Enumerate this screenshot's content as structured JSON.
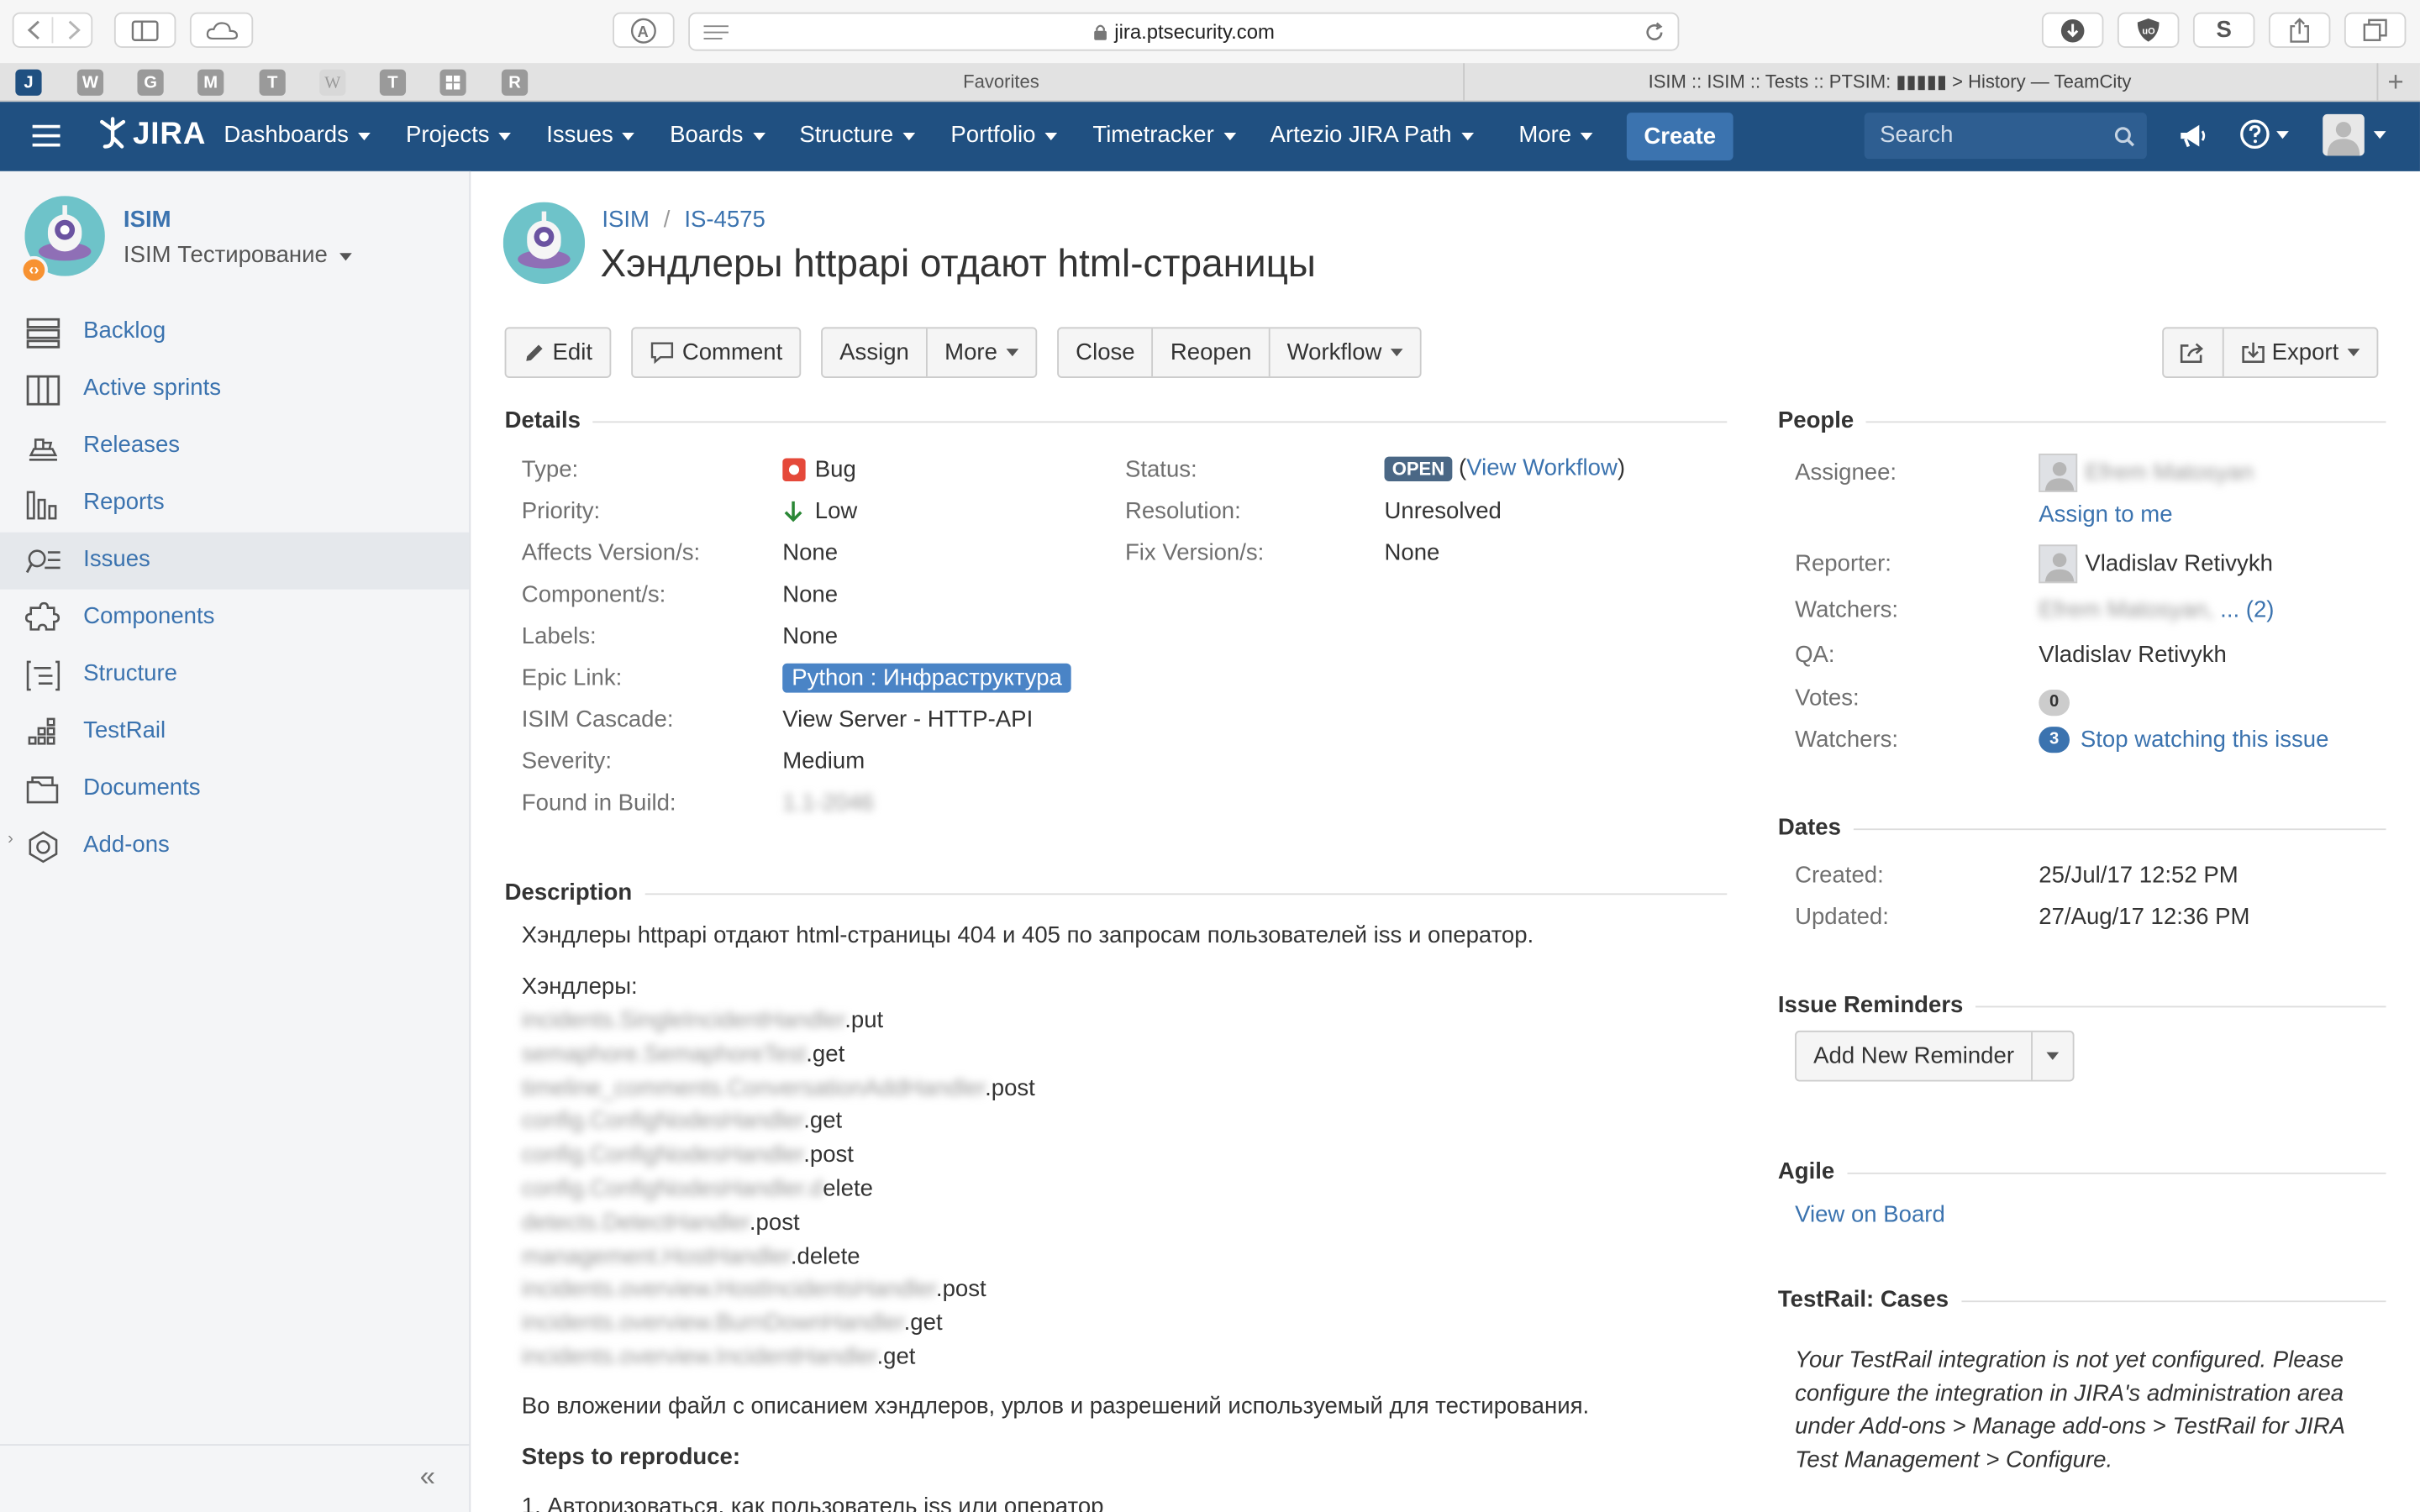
{
  "browser": {
    "url": "jira.ptsecurity.com",
    "favorites_label": "Favorites",
    "tab_title": "ISIM :: ISIM :: Tests :: PTSIM: ▮▮▮▮▮ > History — TeamCity",
    "fav_letters": [
      "J",
      "W",
      "G",
      "M",
      "T",
      "W",
      "T",
      "",
      "R"
    ]
  },
  "header": {
    "logo": "JIRA",
    "nav": [
      "Dashboards",
      "Projects",
      "Issues",
      "Boards",
      "Structure",
      "Portfolio",
      "Timetracker",
      "Artezio JIRA Path",
      "More"
    ],
    "create": "Create",
    "search_placeholder": "Search"
  },
  "sidebar": {
    "project_key": "ISIM",
    "project_name": "ISIM Тестирование",
    "items": [
      {
        "label": "Backlog",
        "icon": "backlog-icon"
      },
      {
        "label": "Active sprints",
        "icon": "sprints-icon"
      },
      {
        "label": "Releases",
        "icon": "releases-icon"
      },
      {
        "label": "Reports",
        "icon": "reports-icon"
      },
      {
        "label": "Issues",
        "icon": "issues-icon"
      },
      {
        "label": "Components",
        "icon": "components-icon"
      },
      {
        "label": "Structure",
        "icon": "structure-icon"
      },
      {
        "label": "TestRail",
        "icon": "testrail-icon"
      },
      {
        "label": "Documents",
        "icon": "documents-icon"
      },
      {
        "label": "Add-ons",
        "icon": "addons-icon"
      }
    ],
    "collapse": "«"
  },
  "issue": {
    "breadcrumb_project": "ISIM",
    "breadcrumb_sep": "/",
    "key": "IS-4575",
    "title": "Хэндлеры httpapi отдают html-страницы"
  },
  "toolbar": {
    "edit": "Edit",
    "comment": "Comment",
    "assign": "Assign",
    "more": "More",
    "close": "Close",
    "reopen": "Reopen",
    "workflow": "Workflow",
    "export": "Export"
  },
  "details": {
    "title": "Details",
    "left": [
      {
        "k": "Type:",
        "v": "Bug"
      },
      {
        "k": "Priority:",
        "v": "Low"
      },
      {
        "k": "Affects Version/s:",
        "v": "None"
      },
      {
        "k": "Component/s:",
        "v": "None"
      },
      {
        "k": "Labels:",
        "v": "None"
      },
      {
        "k": "Epic Link:",
        "v": "Python : Инфраструктура"
      },
      {
        "k": "ISIM Cascade:",
        "v": "View Server - HTTP-API"
      },
      {
        "k": "Severity:",
        "v": "Medium"
      },
      {
        "k": "Found in Build:",
        "v": "1.1-2046"
      }
    ],
    "right": [
      {
        "k": "Status:",
        "v": "OPEN",
        "link": "View Workflow"
      },
      {
        "k": "Resolution:",
        "v": "Unresolved"
      },
      {
        "k": "Fix Version/s:",
        "v": "None"
      }
    ]
  },
  "description": {
    "title": "Description",
    "intro": "Хэндлеры httpapi отдают html-страницы 404 и 405 по запросам пользователей iss и оператор.",
    "handlers_label": "Хэндлеры:",
    "handlers": [
      {
        "hidden": "incidents.SingleIncidentHandler",
        "shown": ".put"
      },
      {
        "hidden": "semaphore.SemaphoreTest",
        "shown": ".get"
      },
      {
        "hidden": "timeline_comments.ConversationAddHandler",
        "shown": ".post"
      },
      {
        "hidden": "config.ConfigNodesHandler",
        "shown": ".get"
      },
      {
        "hidden": "config.ConfigNodesHandler",
        "shown": ".post"
      },
      {
        "hidden": "config.ConfigNodesHandler.d",
        "shown": "elete"
      },
      {
        "hidden": "detects.DetectHandler",
        "shown": ".post"
      },
      {
        "hidden": "management.HostHandler",
        "shown": ".delete"
      },
      {
        "hidden": "incidents.overview.HostIncidentsHandler",
        "shown": ".post"
      },
      {
        "hidden": "incidents.overview.BurnDownHandler",
        "shown": ".get"
      },
      {
        "hidden": "incidents.overview.IncidentHandler",
        "shown": ".get"
      }
    ],
    "attachment_note": "Во вложении файл с описанием хэндлеров, урлов и разрешений используемый для тестирования.",
    "steps_title": "Steps to reproduce:",
    "step1": "1. Авторизоваться, как пользователь iss или оператор"
  },
  "people": {
    "title": "People",
    "assignee_label": "Assignee:",
    "assignee": "Efrem Matosyan",
    "assign_to_me": "Assign to me",
    "reporter_label": "Reporter:",
    "reporter": "Vladislav Retivykh",
    "watchers_label": "Watchers:",
    "watchers_hidden": "Efrem Matosyan,",
    "watchers_more": "... (2)",
    "qa_label": "QA:",
    "qa": "Vladislav Retivykh",
    "votes_label": "Votes:",
    "votes": "0",
    "watchers2_label": "Watchers:",
    "watchers_count": "3",
    "stop_watching": "Stop watching this issue"
  },
  "dates": {
    "title": "Dates",
    "created_label": "Created:",
    "created": "25/Jul/17 12:52 PM",
    "updated_label": "Updated:",
    "updated": "27/Aug/17 12:36 PM"
  },
  "reminders": {
    "title": "Issue Reminders",
    "button": "Add New Reminder"
  },
  "agile": {
    "title": "Agile",
    "link": "View on Board"
  },
  "testrail": {
    "title": "TestRail: Cases",
    "message": "Your TestRail integration is not yet configured. Please configure the integration in JIRA's administration area under Add-ons > Manage add-ons > TestRail for JIRA Test Management > Configure."
  }
}
